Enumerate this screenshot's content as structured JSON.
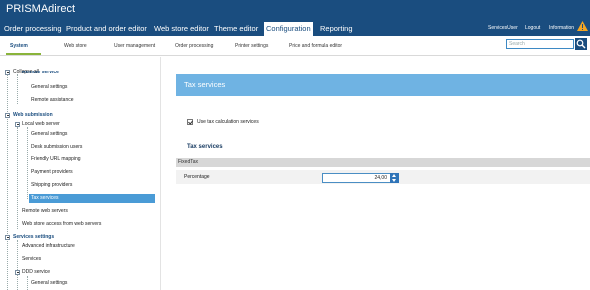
{
  "app": {
    "title": "PRISMAdirect"
  },
  "nav": {
    "tabs": [
      "Order processing",
      "Product and order editor",
      "Web store editor",
      "Theme editor",
      "Configuration",
      "Reporting"
    ],
    "active": "Configuration",
    "user": "ServicesUser",
    "logout": "Logout",
    "information": "Information"
  },
  "subnav": {
    "items": [
      "System",
      "Web store",
      "User management",
      "Order processing",
      "Printer settings",
      "Price and formula editor"
    ],
    "active": "System"
  },
  "search": {
    "placeholder": "Search"
  },
  "tree": {
    "collapse_all": "Collapse all",
    "rows": [
      "Remote service",
      "General settings",
      "Remote assistance",
      "Web submission",
      "Local web server",
      "General settings",
      "Desk submission users",
      "Friendly URL mapping",
      "Payment providers",
      "Shipping providers",
      "Tax services",
      "Remote web servers",
      "Web store access from web servers",
      "Services settings",
      "Advanced infrastructure",
      "Services",
      "DDD service",
      "General settings"
    ]
  },
  "main": {
    "title": "Tax services",
    "use_tax_label": "Use tax calculation services",
    "use_tax_checked": true,
    "section": "Tax services",
    "group": "FixedTax",
    "percentage_label": "Percentage",
    "percentage_value": "24,00"
  },
  "colors": {
    "header": "#1a4d7f",
    "accent": "#6fb3e3",
    "selected": "#4a9bd6",
    "green": "#8ab43b",
    "warning": "#f5a623"
  }
}
